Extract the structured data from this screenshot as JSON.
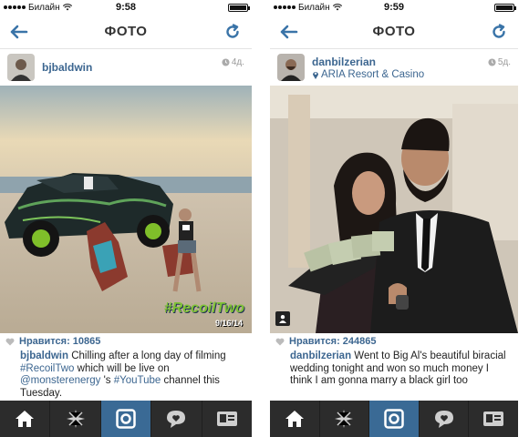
{
  "screens": [
    {
      "status": {
        "carrier": "Билайн",
        "time": "9:58"
      },
      "nav": {
        "title": "ФОТО"
      },
      "post": {
        "username": "bjbaldwin",
        "time_ago": "4д.",
        "photo_alt": "Beach scene with Monster Energy trophy truck and man in Adirondack chair",
        "watermark_tag": "#RecoilTwo",
        "watermark_date": "9/16/14",
        "likes": "Нравится: 10865",
        "caption": {
          "user": "bjbaldwin",
          "p1": " Chilling after a long day of filming ",
          "tag1": "#RecoilTwo",
          "p2": " which will be live on ",
          "tag2": "@monsterenergy",
          "p3": " 's ",
          "tag3": "#YouTube",
          "p4": " channel this Tuesday."
        }
      }
    },
    {
      "status": {
        "carrier": "Билайн",
        "time": "9:59"
      },
      "nav": {
        "title": "ФОТО"
      },
      "post": {
        "username": "danbilzerian",
        "location": "ARIA Resort & Casino",
        "time_ago": "5д.",
        "likes": "Нравится: 244865",
        "caption": {
          "user": "danbilzerian",
          "p1": " Went to Big Al's beautiful biracial wedding tonight and won so much money I think I am gonna marry a black girl too"
        }
      }
    }
  ],
  "tabs": [
    "home-tab",
    "explore-tab",
    "camera-tab",
    "activity-tab",
    "profile-tab"
  ],
  "colors": {
    "link": "#3c6690",
    "tab_bar": "#2c2c2c",
    "tab_active": "#3a6a95",
    "nav_accent": "#3a74a8"
  }
}
